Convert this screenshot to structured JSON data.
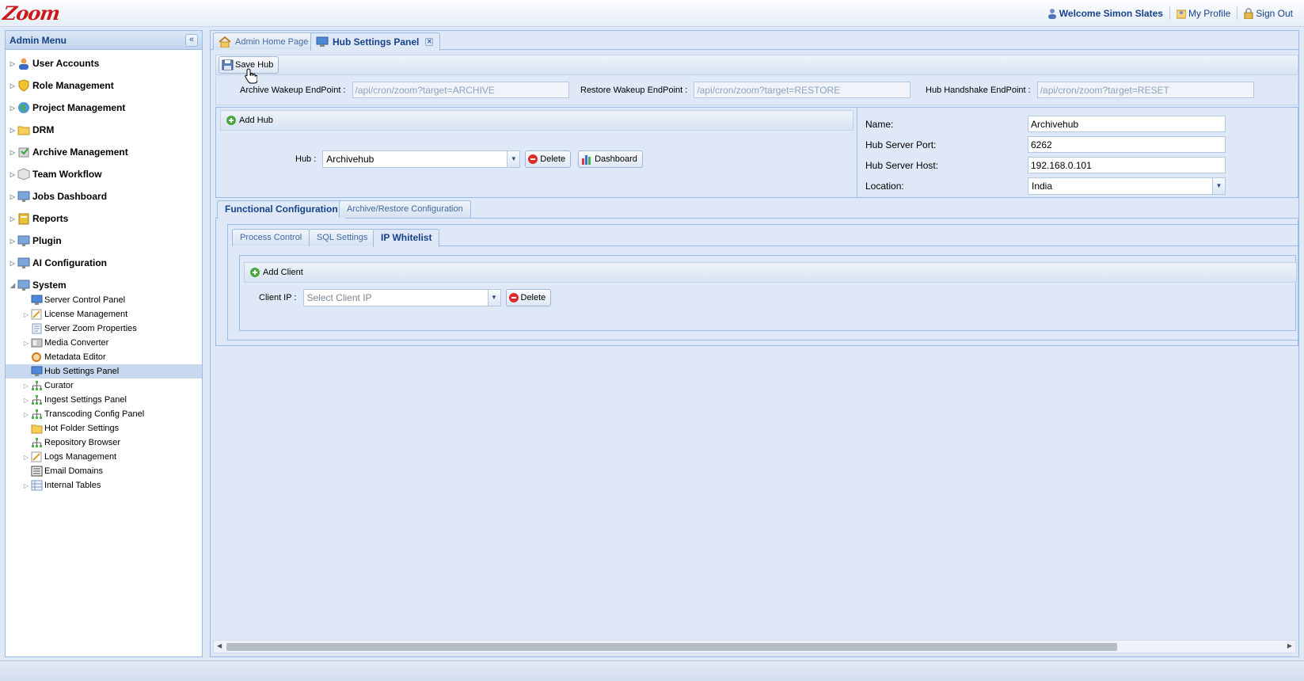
{
  "header": {
    "logo": "Zoom",
    "welcome": "Welcome Simon Slates",
    "my_profile": "My Profile",
    "sign_out": "Sign Out"
  },
  "sidebar": {
    "title": "Admin Menu",
    "collapse_glyph": "«",
    "nodes": [
      {
        "label": "User Accounts",
        "icon": "user-icon"
      },
      {
        "label": "Role Management",
        "icon": "shield-icon"
      },
      {
        "label": "Project Management",
        "icon": "globe-icon"
      },
      {
        "label": "DRM",
        "icon": "folder-icon"
      },
      {
        "label": "Archive Management",
        "icon": "archive-icon"
      },
      {
        "label": "Team Workflow",
        "icon": "cube-icon"
      },
      {
        "label": "Jobs Dashboard",
        "icon": "monitor-icon"
      },
      {
        "label": "Reports",
        "icon": "report-icon"
      },
      {
        "label": "Plugin",
        "icon": "monitor-icon"
      },
      {
        "label": "AI Configuration",
        "icon": "monitor-icon"
      },
      {
        "label": "System",
        "icon": "monitor-icon"
      }
    ],
    "system_children": [
      {
        "label": "Server Control Panel",
        "expandable": false,
        "icon": "monitor-icon"
      },
      {
        "label": "License Management",
        "expandable": true,
        "icon": "license-icon"
      },
      {
        "label": "Server Zoom Properties",
        "expandable": false,
        "icon": "document-icon"
      },
      {
        "label": "Media Converter",
        "expandable": true,
        "icon": "converter-icon"
      },
      {
        "label": "Metadata Editor",
        "expandable": false,
        "icon": "tag-icon"
      },
      {
        "label": "Hub Settings Panel",
        "expandable": false,
        "icon": "monitor-icon",
        "selected": true
      },
      {
        "label": "Curator",
        "expandable": true,
        "icon": "network-icon"
      },
      {
        "label": "Ingest Settings Panel",
        "expandable": true,
        "icon": "network-icon"
      },
      {
        "label": "Transcoding Config Panel",
        "expandable": true,
        "icon": "network-icon"
      },
      {
        "label": "Hot Folder Settings",
        "expandable": false,
        "icon": "folder-icon"
      },
      {
        "label": "Repository Browser",
        "expandable": false,
        "icon": "network-icon"
      },
      {
        "label": "Logs Management",
        "expandable": true,
        "icon": "license-icon"
      },
      {
        "label": "Email Domains",
        "expandable": false,
        "icon": "list-icon"
      },
      {
        "label": "Internal Tables",
        "expandable": true,
        "icon": "table-icon"
      }
    ]
  },
  "tabs": {
    "home": "Admin Home Page",
    "hub": "Hub Settings Panel"
  },
  "toolbar": {
    "save_hub": "Save Hub"
  },
  "endpoints": {
    "archive_label": "Archive Wakeup EndPoint :",
    "archive_value": "/api/cron/zoom?target=ARCHIVE",
    "restore_label": "Restore Wakeup EndPoint :",
    "restore_value": "/api/cron/zoom?target=RESTORE",
    "handshake_label": "Hub Handshake EndPoint :",
    "handshake_value": "/api/cron/zoom?target=RESET"
  },
  "hub": {
    "add_hub": "Add Hub",
    "hub_label": "Hub :",
    "hub_value": "Archivehub",
    "delete": "Delete",
    "dashboard": "Dashboard"
  },
  "props": {
    "name_label": "Name:",
    "name_value": "Archivehub",
    "port_label": "Hub Server Port:",
    "port_value": "6262",
    "host_label": "Hub Server Host:",
    "host_value": "192.168.0.101",
    "location_label": "Location:",
    "location_value": "India"
  },
  "config_tabs": {
    "functional": "Functional Configuration",
    "archive_restore": "Archive/Restore Configuration"
  },
  "inner_tabs": {
    "process_control": "Process Control",
    "sql_settings": "SQL Settings",
    "ip_whitelist": "IP Whitelist"
  },
  "client": {
    "add_client": "Add Client",
    "client_ip_label": "Client IP :",
    "client_ip_placeholder": "Select Client IP",
    "delete": "Delete"
  }
}
